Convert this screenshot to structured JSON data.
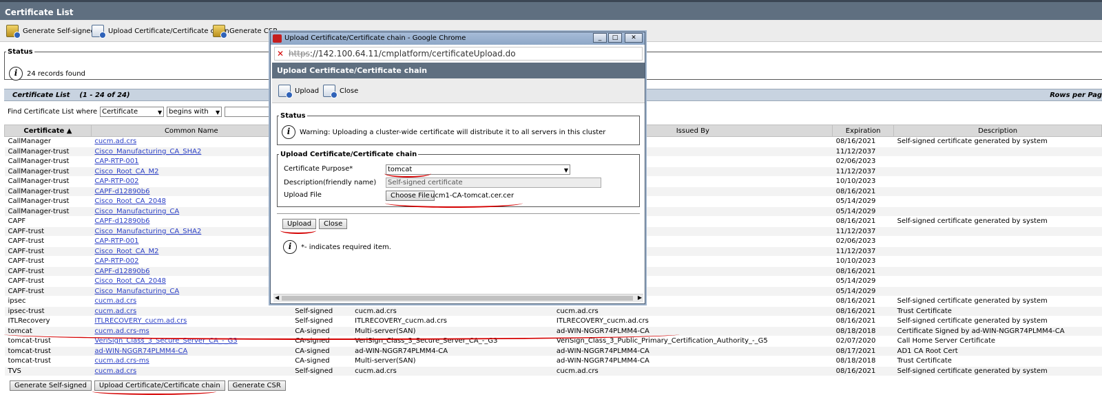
{
  "page": {
    "title": "Certificate List"
  },
  "toolbar": {
    "generate_self_signed": "Generate Self-signed",
    "upload_chain": "Upload Certificate/Certificate chain",
    "generate_csr": "Generate CSR"
  },
  "status": {
    "legend": "Status",
    "message": "24 records found"
  },
  "list": {
    "title": "Certificate List",
    "range": "(1 - 24 of 24)",
    "rows_per_page": "Rows per Pag"
  },
  "find": {
    "prefix": "Find Certificate List where",
    "field": "Certificate",
    "operator": "begins with"
  },
  "table": {
    "headers": [
      "Certificate ▲",
      "Common Name",
      "",
      "",
      "Issued By",
      "Expiration",
      "Description"
    ],
    "rows": [
      [
        "CallManager",
        "cucm.ad.crs",
        "",
        "",
        "",
        "08/16/2021",
        "Self-signed certificate generated by system"
      ],
      [
        "CallManager-trust",
        "Cisco_Manufacturing_CA_SHA2",
        "",
        "",
        "",
        "11/12/2037",
        ""
      ],
      [
        "CallManager-trust",
        "CAP-RTP-001",
        "",
        "",
        "",
        "02/06/2023",
        ""
      ],
      [
        "CallManager-trust",
        "Cisco_Root_CA_M2",
        "",
        "",
        "",
        "11/12/2037",
        ""
      ],
      [
        "CallManager-trust",
        "CAP-RTP-002",
        "",
        "",
        "",
        "10/10/2023",
        ""
      ],
      [
        "CallManager-trust",
        "CAPF-d12890b6",
        "",
        "",
        "",
        "08/16/2021",
        ""
      ],
      [
        "CallManager-trust",
        "Cisco_Root_CA_2048",
        "",
        "",
        "",
        "05/14/2029",
        ""
      ],
      [
        "CallManager-trust",
        "Cisco_Manufacturing_CA",
        "",
        "",
        "",
        "05/14/2029",
        ""
      ],
      [
        "CAPF",
        "CAPF-d12890b6",
        "",
        "",
        "",
        "08/16/2021",
        "Self-signed certificate generated by system"
      ],
      [
        "CAPF-trust",
        "Cisco_Manufacturing_CA_SHA2",
        "",
        "",
        "",
        "11/12/2037",
        ""
      ],
      [
        "CAPF-trust",
        "CAP-RTP-001",
        "",
        "",
        "",
        "02/06/2023",
        ""
      ],
      [
        "CAPF-trust",
        "Cisco_Root_CA_M2",
        "",
        "",
        "",
        "11/12/2037",
        ""
      ],
      [
        "CAPF-trust",
        "CAP-RTP-002",
        "",
        "",
        "",
        "10/10/2023",
        ""
      ],
      [
        "CAPF-trust",
        "CAPF-d12890b6",
        "",
        "",
        "",
        "08/16/2021",
        ""
      ],
      [
        "CAPF-trust",
        "Cisco_Root_CA_2048",
        "",
        "",
        "",
        "05/14/2029",
        ""
      ],
      [
        "CAPF-trust",
        "Cisco_Manufacturing_CA",
        "",
        "",
        "",
        "05/14/2029",
        ""
      ],
      [
        "ipsec",
        "cucm.ad.crs",
        "",
        "",
        "",
        "08/16/2021",
        "Self-signed certificate generated by system"
      ],
      [
        "ipsec-trust",
        "cucm.ad.crs",
        "Self-signed",
        "cucm.ad.crs",
        "cucm.ad.crs",
        "08/16/2021",
        "Trust Certificate"
      ],
      [
        "ITLRecovery",
        "ITLRECOVERY_cucm.ad.crs",
        "Self-signed",
        "ITLRECOVERY_cucm.ad.crs",
        "ITLRECOVERY_cucm.ad.crs",
        "08/16/2021",
        "Self-signed certificate generated by system"
      ],
      [
        "tomcat",
        "cucm.ad.crs-ms",
        "CA-signed",
        "Multi-server(SAN)",
        "ad-WIN-NGGR74PLMM4-CA",
        "08/18/2018",
        "Certificate Signed by ad-WIN-NGGR74PLMM4-CA"
      ],
      [
        "tomcat-trust",
        "VeriSign_Class_3_Secure_Server_CA_-_G3",
        "CA-signed",
        "VeriSign_Class_3_Secure_Server_CA_-_G3",
        "VeriSign_Class_3_Public_Primary_Certification_Authority_-_G5",
        "02/07/2020",
        "Call Home Server Certificate"
      ],
      [
        "tomcat-trust",
        "ad-WIN-NGGR74PLMM4-CA",
        "CA-signed",
        "ad-WIN-NGGR74PLMM4-CA",
        "ad-WIN-NGGR74PLMM4-CA",
        "08/17/2021",
        "AD1 CA Root Cert"
      ],
      [
        "tomcat-trust",
        "cucm.ad.crs-ms",
        "CA-signed",
        "Multi-server(SAN)",
        "ad-WIN-NGGR74PLMM4-CA",
        "08/18/2018",
        "Trust Certificate"
      ],
      [
        "TVS",
        "cucm.ad.crs",
        "Self-signed",
        "cucm.ad.crs",
        "cucm.ad.crs",
        "08/16/2021",
        "Self-signed certificate generated by system"
      ]
    ]
  },
  "bottom": {
    "generate_self_signed": "Generate Self-signed",
    "upload_chain": "Upload Certificate/Certificate chain",
    "generate_csr": "Generate CSR"
  },
  "popup": {
    "window_title": "Upload Certificate/Certificate chain - Google Chrome",
    "url_struck": "https",
    "url_rest": "://142.100.64.11/cmplatform/certificateUpload.do",
    "header": "Upload Certificate/Certificate chain",
    "toolbar": {
      "upload": "Upload",
      "close": "Close"
    },
    "status_legend": "Status",
    "warning": "Warning: Uploading a cluster-wide certificate will distribute it to all servers in this cluster",
    "upload_legend": "Upload Certificate/Certificate chain",
    "purpose_label": "Certificate Purpose*",
    "purpose_value": "tomcat",
    "description_label": "Description(friendly name)",
    "description_value": "Self-signed certificate",
    "file_label": "Upload File",
    "choose_file": "Choose File",
    "file_name": "ucm1-CA-tomcat.cer.cer",
    "upload_btn": "Upload",
    "close_btn": "Close",
    "note": "*- indicates required item."
  }
}
